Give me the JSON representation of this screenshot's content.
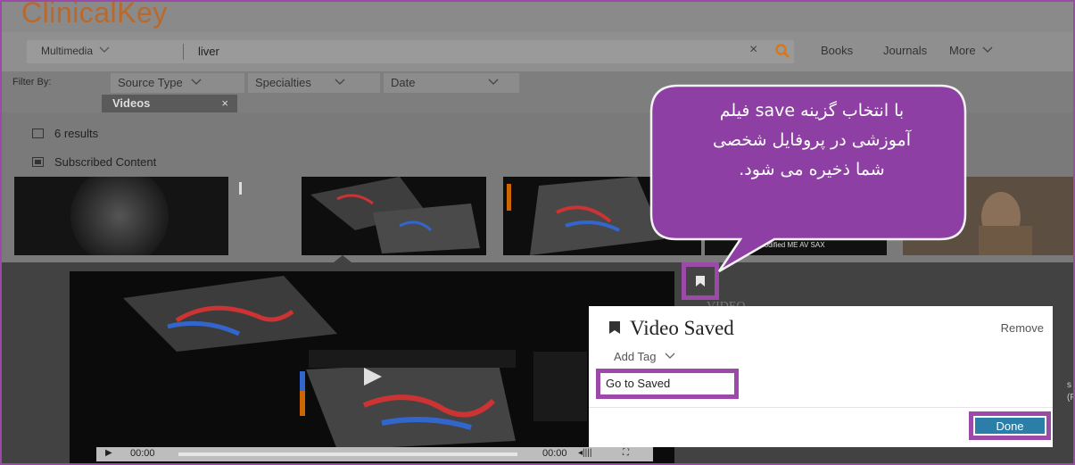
{
  "app": {
    "logo": "ClinicalKey"
  },
  "search": {
    "scope": "Multimedia",
    "query": "liver",
    "clear": "×"
  },
  "nav": {
    "books": "Books",
    "journals": "Journals",
    "more": "More"
  },
  "filters": {
    "label": "Filter By:",
    "dropdowns": [
      {
        "label": "Source Type"
      },
      {
        "label": "Specialties"
      },
      {
        "label": "Date"
      }
    ],
    "active_chip": {
      "label": "Videos",
      "remove": "×"
    }
  },
  "results": {
    "count_label": "6 results",
    "subscribed_label": "Subscribed Content"
  },
  "thumbnails": [
    {
      "caption": ""
    },
    {
      "caption": ""
    },
    {
      "caption": ""
    },
    {
      "caption": "Modified ME AV SAX"
    },
    {
      "caption": ""
    }
  ],
  "player": {
    "current_time": "00:00",
    "end_time": "00:00",
    "overlay_label": "VIDEO"
  },
  "popup": {
    "title": "Video Saved",
    "remove_label": "Remove",
    "add_tag_label": "Add Tag",
    "go_to_saved_label": "Go to Saved",
    "done_label": "Done"
  },
  "callout": {
    "lines": [
      "با انتخاب گزینه  save فیلم",
      "آموزشی در پروفایل شخصی",
      "شما ذخیره می شود."
    ]
  },
  "colors": {
    "highlight": "#9b4aa8",
    "callout_fill": "#8e3fa3",
    "done_button": "#2a7ea8",
    "logo": "#b86a2c",
    "search_icon": "#d47a1e"
  }
}
